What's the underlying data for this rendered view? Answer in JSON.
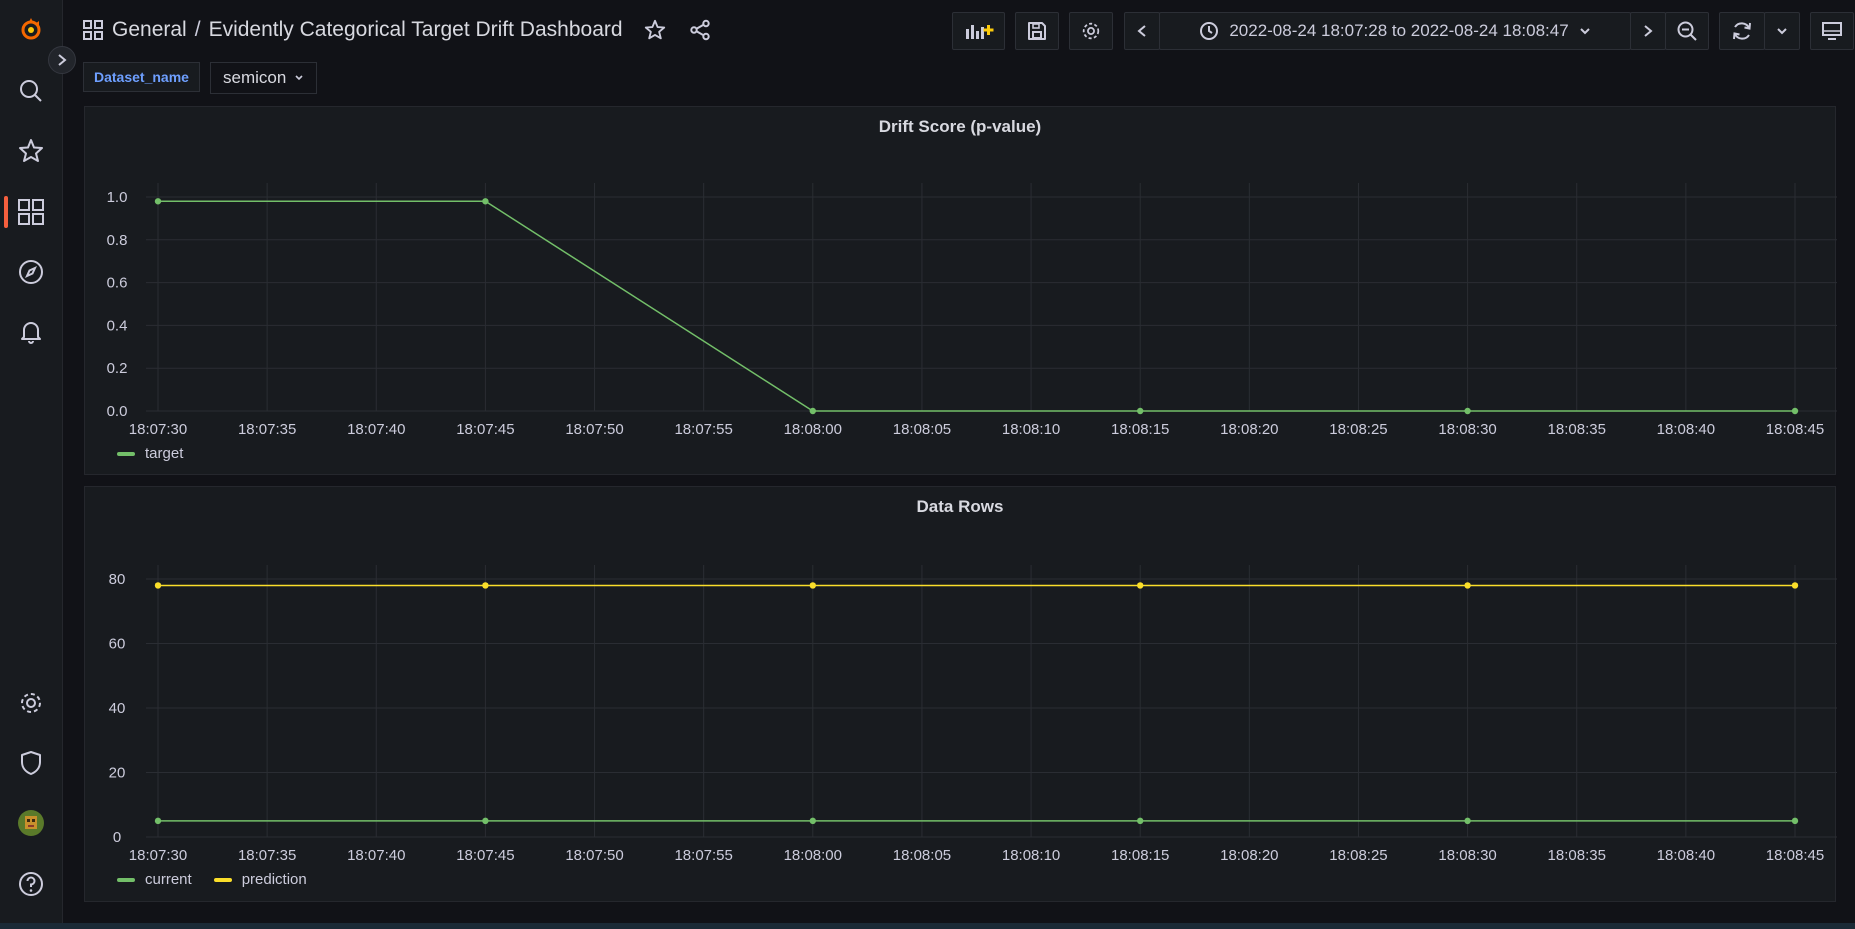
{
  "topbar": {
    "breadcrumb_folder": "General",
    "breadcrumb_separator": "/",
    "dashboard_title": "Evidently Categorical Target Drift Dashboard",
    "time_range": "2022-08-24 18:07:28 to 2022-08-24 18:08:47"
  },
  "variables": {
    "label": "Dataset_name",
    "value": "semicon"
  },
  "panels": [
    {
      "title": "Drift Score (p-value)"
    },
    {
      "title": "Data Rows"
    }
  ],
  "chart_data": [
    {
      "type": "line",
      "title": "Drift Score (p-value)",
      "x": [
        "18:07:30",
        "18:07:45",
        "18:08:00",
        "18:08:15",
        "18:08:30",
        "18:08:45"
      ],
      "x_ticks": [
        "18:07:30",
        "18:07:35",
        "18:07:40",
        "18:07:45",
        "18:07:50",
        "18:07:55",
        "18:08:00",
        "18:08:05",
        "18:08:10",
        "18:08:15",
        "18:08:20",
        "18:08:25",
        "18:08:30",
        "18:08:35",
        "18:08:40",
        "18:08:45"
      ],
      "y_ticks": [
        "1.0",
        "0.8",
        "0.6",
        "0.4",
        "0.2",
        "0.0"
      ],
      "ylim": [
        0,
        1.0
      ],
      "legend": "bottom-left",
      "grid": true,
      "series": [
        {
          "name": "target",
          "color": "#73bf69",
          "values": [
            0.98,
            0.98,
            0.0,
            0.0,
            0.0,
            0.0
          ]
        }
      ]
    },
    {
      "type": "line",
      "title": "Data Rows",
      "x": [
        "18:07:30",
        "18:07:45",
        "18:08:00",
        "18:08:15",
        "18:08:30",
        "18:08:45"
      ],
      "x_ticks": [
        "18:07:30",
        "18:07:35",
        "18:07:40",
        "18:07:45",
        "18:07:50",
        "18:07:55",
        "18:08:00",
        "18:08:05",
        "18:08:10",
        "18:08:15",
        "18:08:20",
        "18:08:25",
        "18:08:30",
        "18:08:35",
        "18:08:40",
        "18:08:45"
      ],
      "y_ticks": [
        "80",
        "60",
        "40",
        "20",
        "0"
      ],
      "ylim": [
        0,
        80
      ],
      "legend": "bottom-left",
      "grid": true,
      "series": [
        {
          "name": "current",
          "color": "#73bf69",
          "values": [
            5,
            5,
            5,
            5,
            5,
            5
          ]
        },
        {
          "name": "prediction",
          "color": "#fade2a",
          "values": [
            78,
            78,
            78,
            78,
            78,
            78
          ]
        }
      ]
    }
  ]
}
